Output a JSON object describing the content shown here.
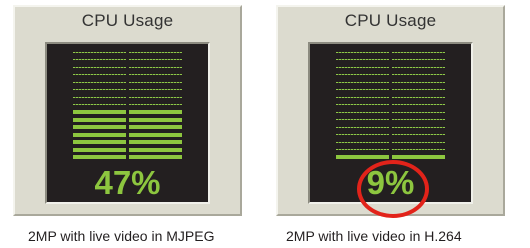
{
  "panels": [
    {
      "title": "CPU Usage",
      "percent_label": "47%",
      "usage_percent": 47,
      "segments_total": 15,
      "segments_lit": 7,
      "caption": "2MP with live video in MJPEG",
      "highlighted": false
    },
    {
      "title": "CPU Usage",
      "percent_label": "9%",
      "usage_percent": 9,
      "segments_total": 15,
      "segments_lit": 1,
      "caption": "2MP with live video in H.264",
      "highlighted": true
    }
  ],
  "colors": {
    "meter_green": "#8dc63f",
    "screen_background": "#231f20",
    "panel_background": "#dcdbcf",
    "highlight_red": "#e2231a"
  }
}
